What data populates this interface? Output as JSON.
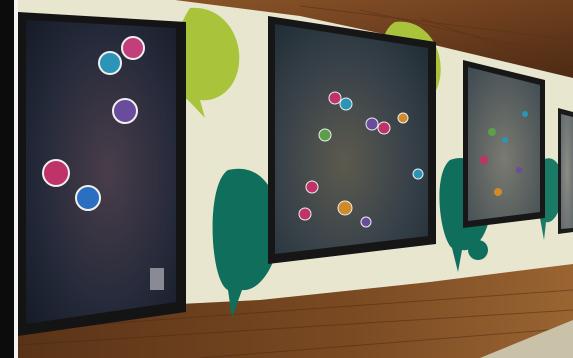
{
  "photo": {
    "subject": "",
    "colors": {
      "wall": "#e9e6cf",
      "wood": "#6e3f1f",
      "lime": "#a9c43a",
      "teal": "#0f6f5c",
      "bezel": "#1a1a1a",
      "screen_dark": "#1b2130"
    }
  }
}
